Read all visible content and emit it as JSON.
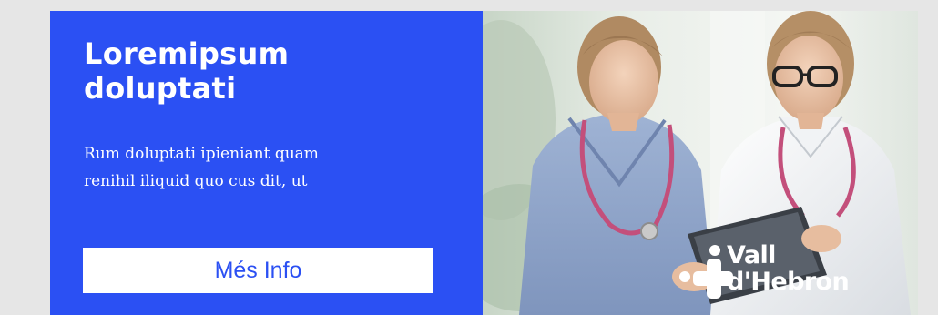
{
  "banner": {
    "headline": [
      "Loremipsum",
      "doluptati"
    ],
    "body": [
      "Rum doluptati ipieniant quam",
      "renihil iliquid quo cus dit, ut"
    ],
    "cta_label": "Més Info",
    "logo_lines": [
      "Vall",
      "d'Hebron"
    ],
    "logo_icon": "cross-with-dots-icon",
    "photo_subject": "doctors-with-tablet-photo"
  },
  "colors": {
    "page_background": "#e6e6e6",
    "brand_blue": "#2b50f3",
    "white": "#ffffff"
  }
}
